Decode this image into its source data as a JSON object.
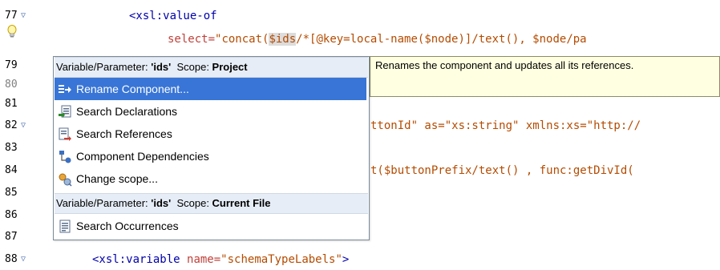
{
  "line_numbers": [
    "77",
    "",
    "79",
    "80",
    "81",
    "82",
    "83",
    "84",
    "85",
    "86",
    "87",
    "88"
  ],
  "code": {
    "l77": "<xsl:value-of",
    "l78_attr": "select=",
    "l78_val_a": "\"concat(",
    "l78_sel": "$ids",
    "l78_val_b": "/*[@key=local-name($node)]/text(), $node/pa",
    "l82": "ttonId\" as=\"xs:string\" xmlns:xs=\"http://",
    "l84": "t($buttonPrefix/text() , func:getDivId(",
    "l88_tag_open": "<xsl:variable ",
    "l88_attr": "name=",
    "l88_val": "\"schemaTypeLabels\"",
    "l88_close": ">"
  },
  "menu": {
    "header1": {
      "prefix": "Variable/Parameter: ",
      "name": "'ids'",
      "scope_label": "  Scope: ",
      "scope": "Project"
    },
    "items1": [
      {
        "label": "Rename Component...",
        "icon": "rename-icon"
      },
      {
        "label": "Search Declarations",
        "icon": "search-declarations-icon"
      },
      {
        "label": "Search References",
        "icon": "search-references-icon"
      },
      {
        "label": "Component Dependencies",
        "icon": "component-dependencies-icon"
      },
      {
        "label": "Change scope...",
        "icon": "change-scope-icon"
      }
    ],
    "header2": {
      "prefix": "Variable/Parameter: ",
      "name": "'ids'",
      "scope_label": "  Scope: ",
      "scope": "Current File"
    },
    "items2": [
      {
        "label": "Search Occurrences",
        "icon": "search-occurrences-icon"
      }
    ]
  },
  "tooltip": {
    "text": "Renames the component and updates all its references."
  },
  "colors": {
    "selection": "#3875d6",
    "header_bg": "#e6edf6",
    "tooltip_bg": "#ffffe1",
    "tag": "#0000aa",
    "attr": "#c0403a",
    "value": "#b54b00"
  }
}
